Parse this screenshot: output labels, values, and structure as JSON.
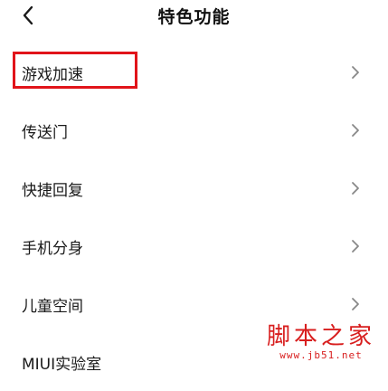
{
  "header": {
    "back_icon": "chevron-left-icon",
    "title": "特色功能"
  },
  "list": {
    "items": [
      {
        "label": "游戏加速",
        "icon": "chevron-right-icon",
        "highlighted": true
      },
      {
        "label": "传送门",
        "icon": "chevron-right-icon"
      },
      {
        "label": "快捷回复",
        "icon": "chevron-right-icon"
      },
      {
        "label": "手机分身",
        "icon": "chevron-right-icon"
      },
      {
        "label": "儿童空间",
        "icon": "chevron-right-icon"
      },
      {
        "label": "MIUI实验室",
        "icon": "chevron-right-icon"
      }
    ]
  },
  "watermark": {
    "text": "脚本之家",
    "url": "www.jb51.net"
  },
  "colors": {
    "highlight_border": "#e1141a",
    "watermark": "#d81e1e",
    "chevron": "#888888"
  }
}
